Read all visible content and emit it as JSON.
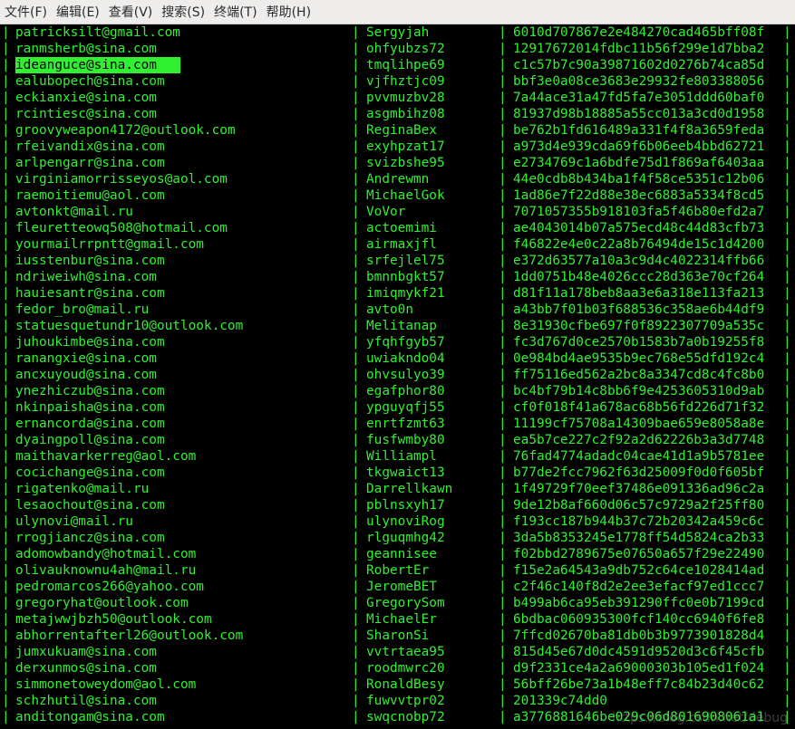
{
  "menubar": {
    "items": [
      {
        "label": "文件(F)"
      },
      {
        "label": "编辑(E)"
      },
      {
        "label": "查看(V)"
      },
      {
        "label": "搜索(S)"
      },
      {
        "label": "终端(T)"
      },
      {
        "label": "帮助(H)"
      }
    ]
  },
  "terminal": {
    "separator": "|",
    "selected_row_index": 2,
    "rows": [
      {
        "email": "patricksilt@gmail.com",
        "user": "Sergyjah",
        "hash": "6010d707867e2e484270cad465bff08f"
      },
      {
        "email": "ranmsherb@sina.com",
        "user": "ohfyubzs72",
        "hash": "12917672014fdbc11b56f299e1d7bba2"
      },
      {
        "email": "ideanguce@sina.com",
        "user": "tmqlihpe69",
        "hash": "c1c57b7c90a39871602d0276b74ca85d"
      },
      {
        "email": "ealubopech@sina.com",
        "user": "vjfhztjc09",
        "hash": "bbf3e0a08ce3683e29932fe803388056"
      },
      {
        "email": "eckianxie@sina.com",
        "user": "pvvmuzbv28",
        "hash": "7a44ace31a47fd5fa7e3051ddd60baf0"
      },
      {
        "email": "rcintiesc@sina.com",
        "user": "asgmbihz08",
        "hash": "81937d98b18885a55cc013a3cd0d1958"
      },
      {
        "email": "groovyweapon4172@outlook.com",
        "user": "ReginaBex",
        "hash": "be762b1fd616489a331f4f8a3659feda"
      },
      {
        "email": "rfeivandix@sina.com",
        "user": "exyhpzat17",
        "hash": "a973d4e939cda69f6b06eeb4bbd62721"
      },
      {
        "email": "arlpengarr@sina.com",
        "user": "svizbshe95",
        "hash": "e2734769c1a6bdfe75d1f869af6403aa"
      },
      {
        "email": "virginiamorrisseyos@aol.com",
        "user": "Andrewmn",
        "hash": "44e0cdb8b434ba1f4f58ce5351c12b06"
      },
      {
        "email": "raemoitiemu@aol.com",
        "user": "MichaelGok",
        "hash": "1ad86e7f22d88e38ec6883a5334f8cd5"
      },
      {
        "email": "avtonkt@mail.ru",
        "user": "VoVor",
        "hash": "7071057355b918103fa5f46b80efd2a7"
      },
      {
        "email": "fleuretteowq508@hotmail.com",
        "user": "actoemimi",
        "hash": "ae4043014b07a575ecd48c44d83cfb73"
      },
      {
        "email": "yourmailrrpntt@gmail.com",
        "user": "airmaxjfl",
        "hash": "f46822e4e0c22a8b76494de15c1d4200"
      },
      {
        "email": "iusstenbur@sina.com",
        "user": "srfejlel75",
        "hash": "e372d63577a10a3c9d4c4022314ffb66"
      },
      {
        "email": "ndriweiwh@sina.com",
        "user": "bmnnbgkt57",
        "hash": "1dd0751b48e4026ccc28d363e70cf264"
      },
      {
        "email": "hauiesantr@sina.com",
        "user": "imiqmykf21",
        "hash": "d81f11a178beb8aa3e6a318e113fa213"
      },
      {
        "email": "fedor_bro@mail.ru",
        "user": "avto0n",
        "hash": "a43bb7f01b03f688536c358ae6b44df9"
      },
      {
        "email": "statuesquetundr10@outlook.com",
        "user": "Melitanap",
        "hash": "8e31930cfbe697f0f8922307709a535c"
      },
      {
        "email": "juhoukimbe@sina.com",
        "user": "yfqhfgyb57",
        "hash": "fc3d767d0ce2570b1583b7a0b19255f8"
      },
      {
        "email": "ranangxie@sina.com",
        "user": "uwiakndo04",
        "hash": "0e984bd4ae9535b9ec768e55dfd192c4"
      },
      {
        "email": "ancxuyoud@sina.com",
        "user": "ohvsulyo39",
        "hash": "ff75116ed562a2bc8a3347cd8c4fc8b0"
      },
      {
        "email": "ynezhiczub@sina.com",
        "user": "egafphor80",
        "hash": "bc4bf79b14c8bb6f9e4253605310d9ab"
      },
      {
        "email": "nkinpaisha@sina.com",
        "user": "ypguyqfj55",
        "hash": "cf0f018f41a678ac68b56fd226d71f32"
      },
      {
        "email": "ernancorda@sina.com",
        "user": "enrtfzmt63",
        "hash": "11199cf75708a14309bae659e8058a8e"
      },
      {
        "email": "dyaingpoll@sina.com",
        "user": "fusfwmby80",
        "hash": "ea5b7ce227c2f92a2d62226b3a3d7748"
      },
      {
        "email": "maithavarkerreg@aol.com",
        "user": "Williampl",
        "hash": "76fad4774adadc04cae41d1a9b5781ee"
      },
      {
        "email": "cocichange@sina.com",
        "user": "tkgwaict13",
        "hash": "b77de2fcc7962f63d25009f0d0f605bf"
      },
      {
        "email": "rigatenko@mail.ru",
        "user": "Darrellkawn",
        "hash": "1f49729f70eef37486e091336ad96c2a"
      },
      {
        "email": "lesaochout@sina.com",
        "user": "pblnsxyh17",
        "hash": "9de12b8af660d06c57c9729a2f25ff80"
      },
      {
        "email": "ulynovi@mail.ru",
        "user": "ulynoviRog",
        "hash": "f193cc187b944b37c72b20342a459c6c"
      },
      {
        "email": "rrogjiancz@sina.com",
        "user": "rlguqmhg42",
        "hash": "3da5b8353245e1778ff54d5824ca2b33"
      },
      {
        "email": "adomowbandy@hotmail.com",
        "user": "geannisee",
        "hash": "f02bbd2789675e07650a657f29e22490"
      },
      {
        "email": "olivauknownu4ah@mail.ru",
        "user": "RobertEr",
        "hash": "f15e2a64543a9db752c64ce1028414ad"
      },
      {
        "email": "pedromarcos266@yahoo.com",
        "user": "JeromeBET",
        "hash": "c2f46c140f8d2e2ee3efacf97ed1ccc7"
      },
      {
        "email": "gregoryhat@outlook.com",
        "user": "GregorySom",
        "hash": "b499ab6ca95eb391290ffc0e0b7199cd"
      },
      {
        "email": "metajwwjbzh50@outlook.com",
        "user": "MichaelEr",
        "hash": "6bdbac060935300fcf140cc6940f6fe8"
      },
      {
        "email": "abhorrentafterl26@outlook.com",
        "user": "SharonSi",
        "hash": "7ffcd02670ba81db0b3b9773901828d4"
      },
      {
        "email": "jumxukuam@sina.com",
        "user": "vvtrtaea95",
        "hash": "815d45e67d0dc4591d9520d3c6f45cfb"
      },
      {
        "email": "derxunmos@sina.com",
        "user": "roodmwrc20",
        "hash": "d9f2331ce4a2a69000303b105ed1f024"
      },
      {
        "email": "simmonetoweydom@aol.com",
        "user": "RonaldBesy",
        "hash": "56bff26be73a1b48eff7c84b23d40c62"
      },
      {
        "email": "schzhutil@sina.com",
        "user": "fuwvvtpr02",
        "hash": "201339c74dd0"
      },
      {
        "email": "anditongam@sina.com",
        "user": "swqcnobp72",
        "hash": "a3776881646be029c06d8016908061a1"
      }
    ]
  },
  "watermark": "https://blog.csdn.net/debug"
}
